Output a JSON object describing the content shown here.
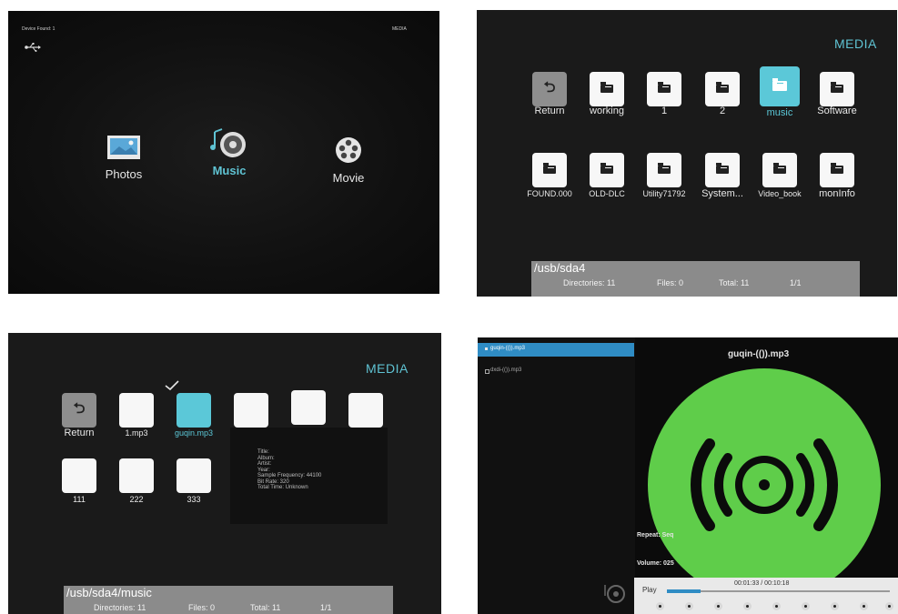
{
  "panel1": {
    "device_found_label": "Device Found:",
    "device_found_count": "1",
    "media_label": "MEDIA",
    "usb_icon": "usb-icon",
    "categories": [
      {
        "label": "Photos",
        "icon": "photos-icon"
      },
      {
        "label": "Music",
        "icon": "music-icon"
      },
      {
        "label": "Movie",
        "icon": "movie-icon"
      }
    ]
  },
  "panel2": {
    "media_label": "MEDIA",
    "items": [
      {
        "label": "Return",
        "type": "return"
      },
      {
        "label": "working",
        "type": "folder"
      },
      {
        "label": "1",
        "type": "folder"
      },
      {
        "label": "2",
        "type": "folder"
      },
      {
        "label": "music",
        "type": "folder",
        "selected": true
      },
      {
        "label": "Software",
        "type": "folder"
      },
      {
        "label": "FOUND.000",
        "type": "folder"
      },
      {
        "label": "OLD-DLC",
        "type": "folder"
      },
      {
        "label": "Utility71792",
        "type": "folder"
      },
      {
        "label": "System...",
        "type": "folder"
      },
      {
        "label": "Video_book",
        "type": "folder"
      },
      {
        "label": "monInfo",
        "type": "folder"
      }
    ],
    "path": "/usb/sda4",
    "status": {
      "directories": "Directories: 11",
      "files": "Files: 0",
      "total": "Total: 11",
      "page": "1/1"
    }
  },
  "panel3": {
    "media_label": "MEDIA",
    "items": [
      {
        "label": "Return",
        "type": "return"
      },
      {
        "label": "1.mp3",
        "type": "file"
      },
      {
        "label": "guqin.mp3",
        "type": "file",
        "selected": true
      },
      {
        "label": "",
        "type": "file"
      },
      {
        "label": "",
        "type": "file"
      },
      {
        "label": "",
        "type": "file"
      },
      {
        "label": "111",
        "type": "file"
      },
      {
        "label": "222",
        "type": "file"
      },
      {
        "label": "333",
        "type": "file"
      }
    ],
    "info": [
      "Title:",
      "Album:",
      "Artist:",
      "Year:",
      "Sample Frequency: 44100",
      "Bit Rate: 320",
      "Total Time: Unknown"
    ],
    "path": "/usb/sda4/music",
    "status": {
      "directories": "Directories: 11",
      "files": "Files: 0",
      "total": "Total: 11",
      "page": "1/1"
    }
  },
  "panel4": {
    "playlist": [
      "guqin-(()).mp3",
      "dxdi-(()).mp3"
    ],
    "now_playing": "guqin-(()).mp3",
    "repeat": "Repeat: Seq",
    "volume": "Volume: 025",
    "play_label": "Play",
    "time": "00:01:33 / 00:10:18",
    "progress": 0.15,
    "disc_color": "#5fcd4a"
  }
}
